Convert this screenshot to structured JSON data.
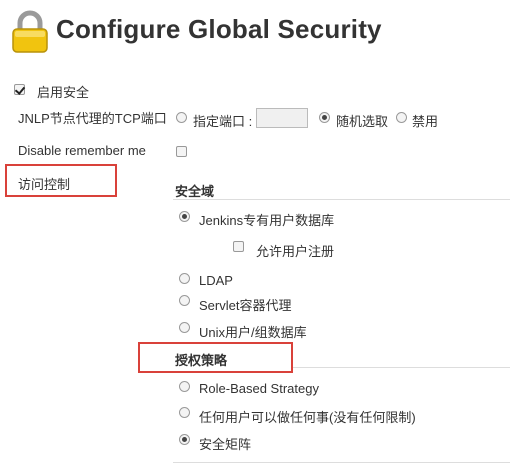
{
  "page": {
    "title": "Configure Global Security"
  },
  "enable_security": {
    "label": "启用安全",
    "checked": true
  },
  "jnlp": {
    "label": "JNLP节点代理的TCP端口",
    "options": [
      {
        "label": "指定端口 :",
        "checked": false
      },
      {
        "label": "随机选取",
        "checked": true
      },
      {
        "label": "禁用",
        "checked": false
      }
    ],
    "port_value": ""
  },
  "disable_remember_me": {
    "label": "Disable remember me",
    "checked": false
  },
  "access_control": {
    "label": "访问控制"
  },
  "security_realm": {
    "heading": "安全域",
    "options": [
      {
        "label": "Jenkins专有用户数据库",
        "checked": true
      },
      {
        "label": "LDAP",
        "checked": false
      },
      {
        "label": "Servlet容器代理",
        "checked": false
      },
      {
        "label": "Unix用户/组数据库",
        "checked": false
      }
    ],
    "allow_signup": {
      "label": "允许用户注册",
      "checked": false
    }
  },
  "authorization": {
    "heading": "授权策略",
    "options": [
      {
        "label": "Role-Based Strategy",
        "checked": false
      },
      {
        "label": "任何用户可以做任何事(没有任何限制)",
        "checked": false
      },
      {
        "label": "安全矩阵",
        "checked": true
      }
    ]
  },
  "colors": {
    "highlight": "#d9413a",
    "lock_body": "#f1c40f"
  }
}
